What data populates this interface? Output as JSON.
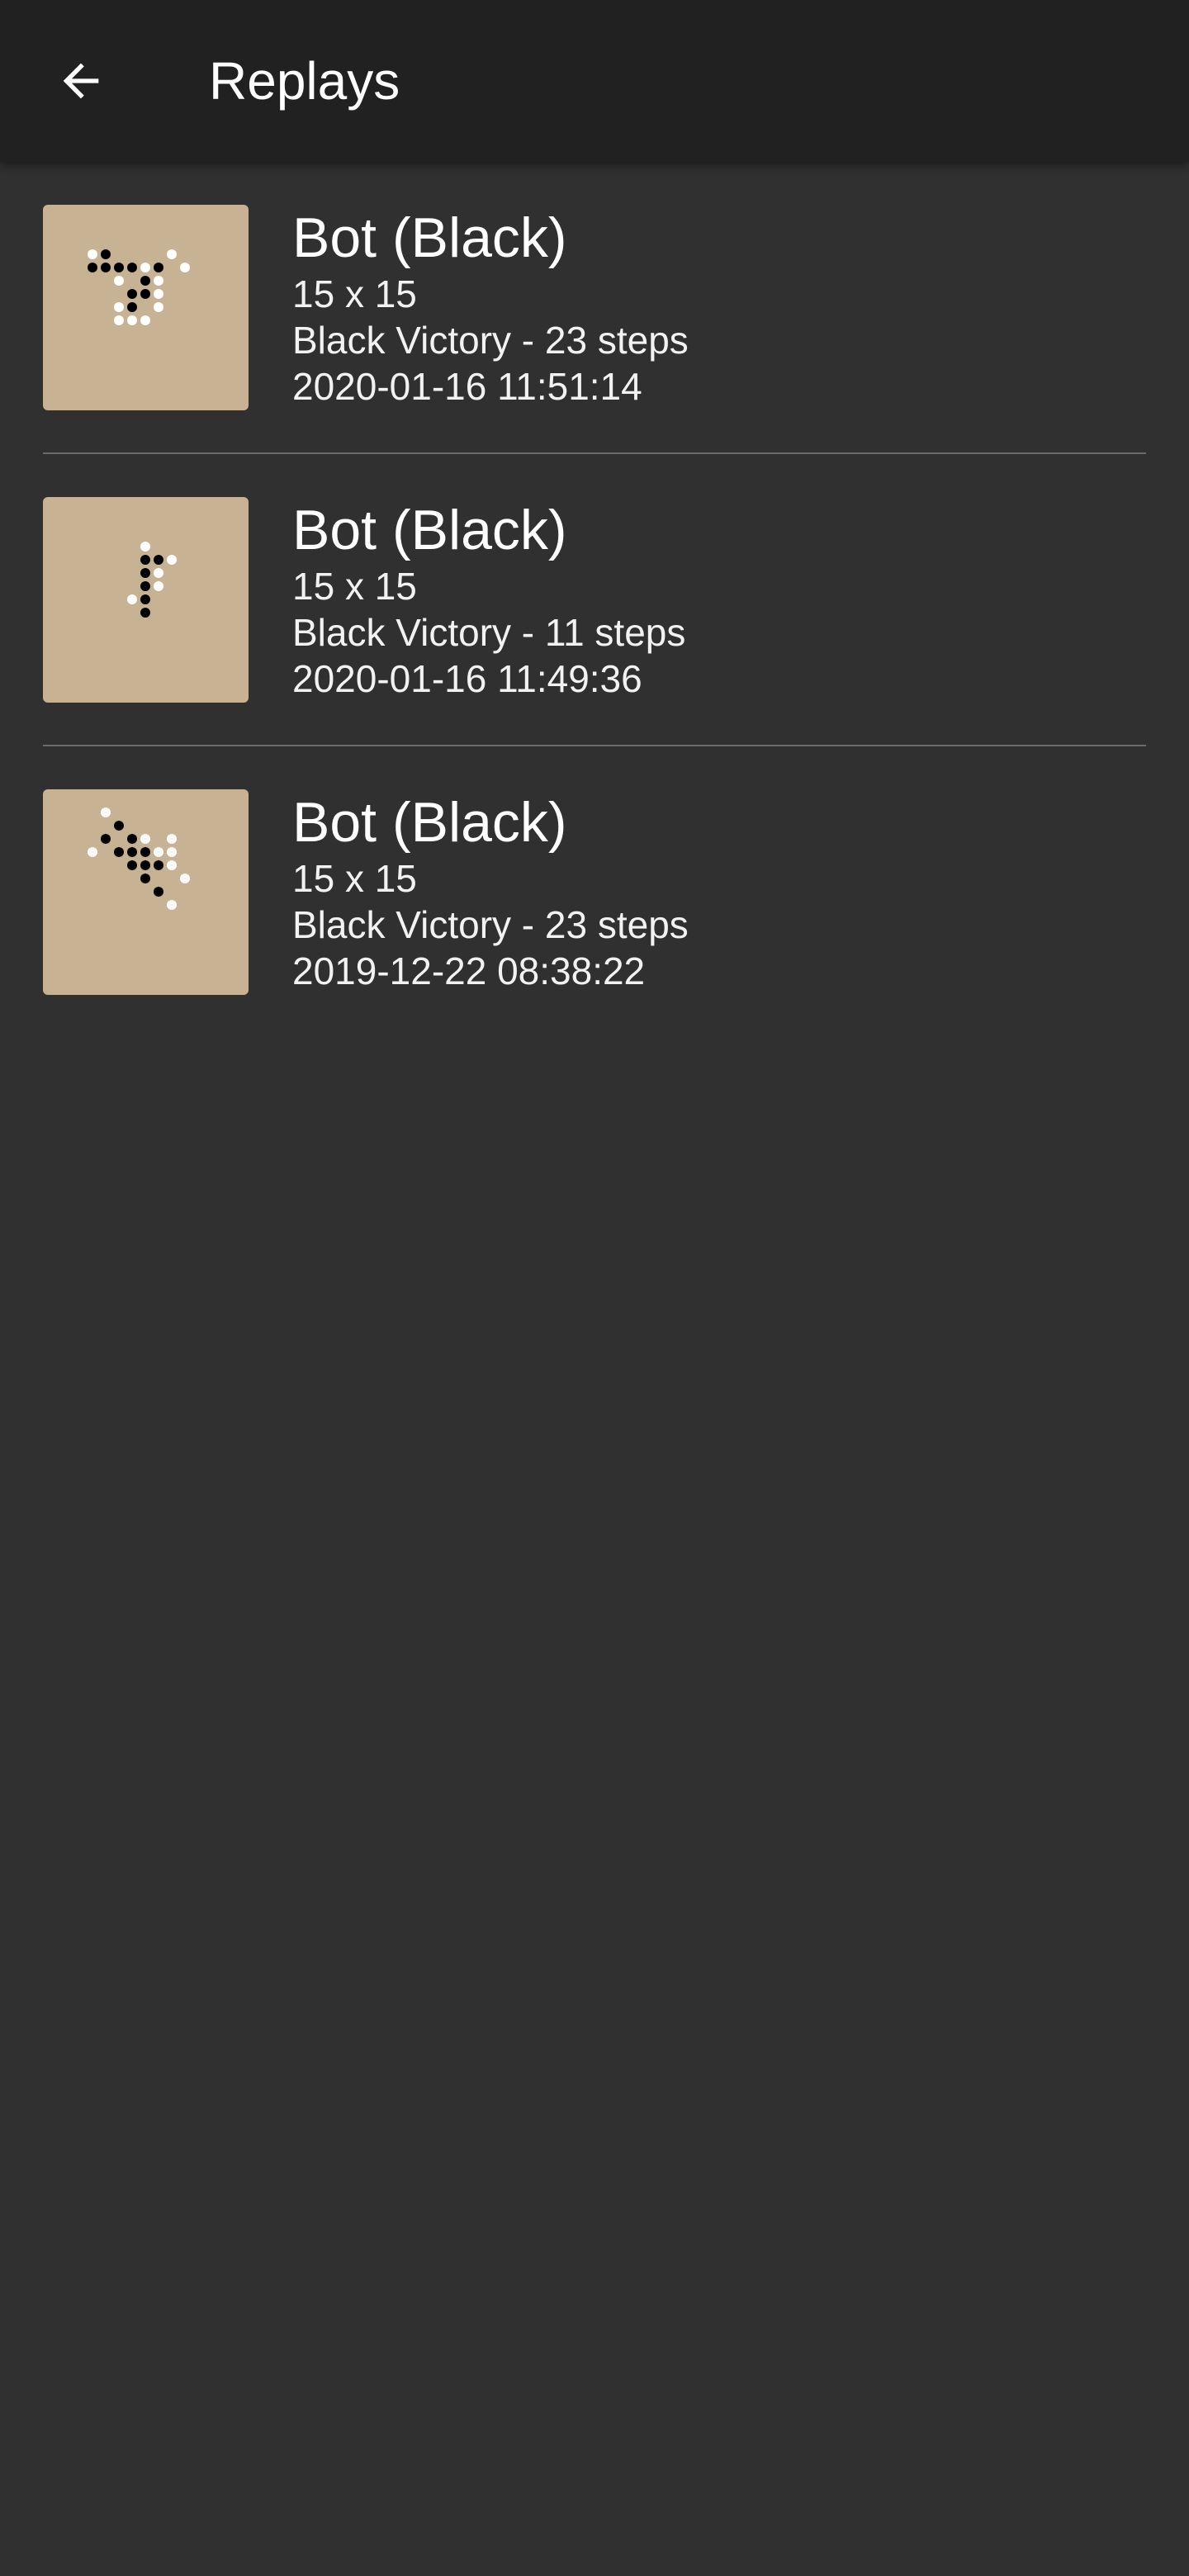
{
  "app_bar": {
    "title": "Replays",
    "back_icon": "arrow-left-icon"
  },
  "colors": {
    "app_bar_bg": "#212121",
    "page_bg": "#303030",
    "board_bg": "#c7b394",
    "divider": "#6a6a6a",
    "text": "#ffffff"
  },
  "replays": [
    {
      "player": "Bot (Black)",
      "board_size": "15 x 15",
      "result": "Black Victory - 23 steps",
      "date": "2020-01-16 11:51:14",
      "stones": {
        "black": [
          [
            4,
            3
          ],
          [
            3,
            4
          ],
          [
            4,
            4
          ],
          [
            5,
            4
          ],
          [
            6,
            4
          ],
          [
            8,
            4
          ],
          [
            7,
            5
          ],
          [
            6,
            6
          ],
          [
            7,
            6
          ],
          [
            6,
            7
          ]
        ],
        "white": [
          [
            3,
            3
          ],
          [
            9,
            3
          ],
          [
            6,
            4
          ],
          [
            7,
            4
          ],
          [
            10,
            4
          ],
          [
            5,
            5
          ],
          [
            8,
            5
          ],
          [
            8,
            6
          ],
          [
            5,
            7
          ],
          [
            8,
            7
          ],
          [
            5,
            8
          ],
          [
            6,
            8
          ],
          [
            7,
            8
          ]
        ]
      }
    },
    {
      "player": "Bot (Black)",
      "board_size": "15 x 15",
      "result": "Black Victory - 11 steps",
      "date": "2020-01-16 11:49:36",
      "stones": {
        "black": [
          [
            7,
            4
          ],
          [
            8,
            4
          ],
          [
            7,
            5
          ],
          [
            7,
            6
          ],
          [
            7,
            7
          ],
          [
            7,
            8
          ]
        ],
        "white": [
          [
            7,
            3
          ],
          [
            9,
            4
          ],
          [
            8,
            5
          ],
          [
            8,
            6
          ],
          [
            6,
            7
          ]
        ]
      }
    },
    {
      "player": "Bot (Black)",
      "board_size": "15 x 15",
      "result": "Black Victory - 23 steps",
      "date": "2019-12-22 08:38:22",
      "stones": {
        "black": [
          [
            5,
            2
          ],
          [
            4,
            3
          ],
          [
            6,
            3
          ],
          [
            5,
            4
          ],
          [
            6,
            4
          ],
          [
            7,
            4
          ],
          [
            6,
            5
          ],
          [
            7,
            5
          ],
          [
            8,
            5
          ],
          [
            7,
            6
          ],
          [
            8,
            7
          ]
        ],
        "white": [
          [
            4,
            1
          ],
          [
            5,
            2
          ],
          [
            7,
            3
          ],
          [
            9,
            3
          ],
          [
            3,
            4
          ],
          [
            8,
            4
          ],
          [
            9,
            4
          ],
          [
            9,
            5
          ],
          [
            10,
            6
          ],
          [
            9,
            8
          ]
        ]
      }
    }
  ]
}
